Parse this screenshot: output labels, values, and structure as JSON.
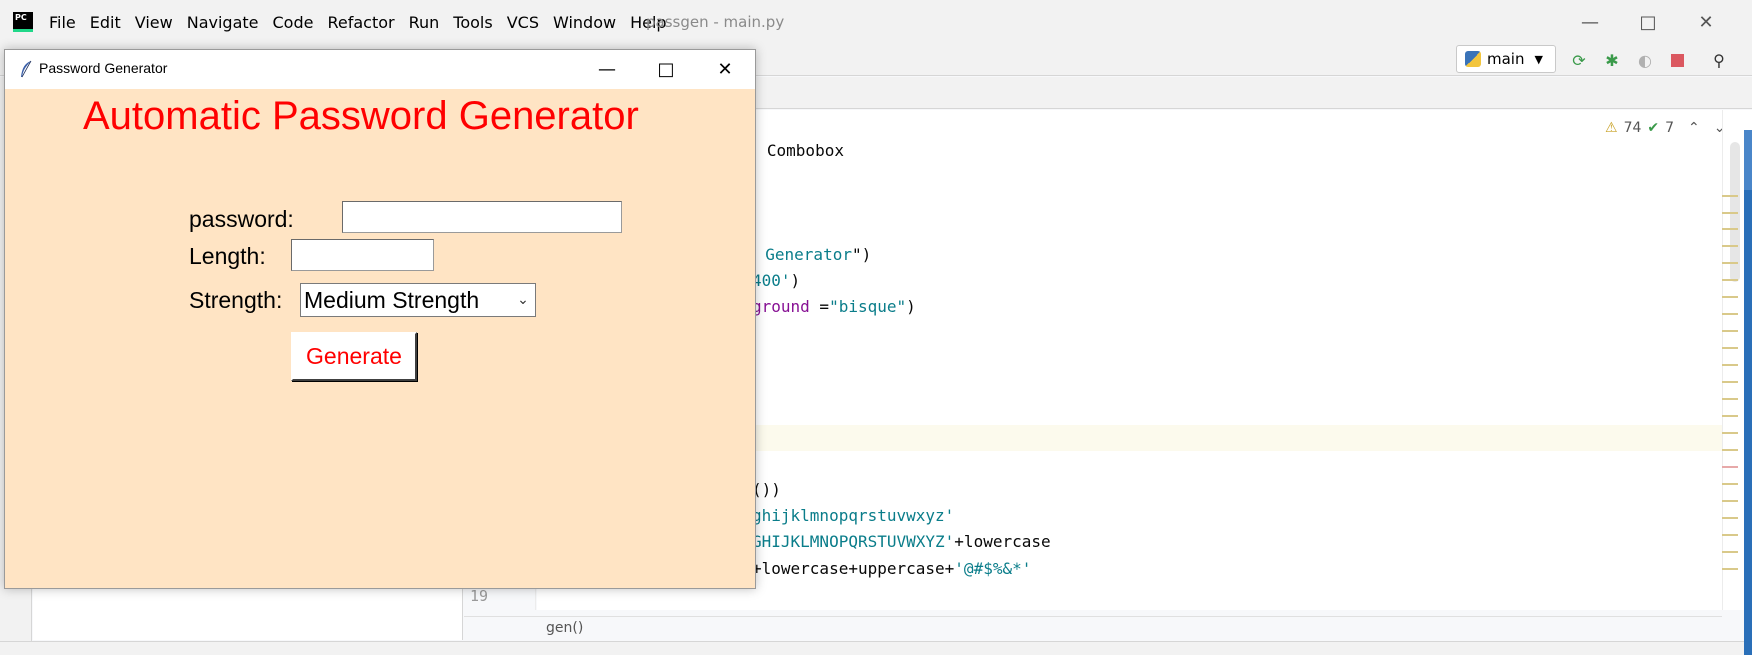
{
  "ide": {
    "title": "passgen - main.py",
    "logo_text": "PC",
    "menu": [
      "File",
      "Edit",
      "View",
      "Navigate",
      "Code",
      "Refactor",
      "Run",
      "Tools",
      "VCS",
      "Window",
      "Help"
    ],
    "run_config": "main",
    "inspections": {
      "warnings": "74",
      "typos": "7"
    },
    "line_number_visible": "19",
    "breadcrumb": "gen()",
    "code_fragments": [
      {
        "text": "rt Combobox"
      },
      {
        "text": "d Generator\")"
      },
      {
        "text": "400')"
      },
      {
        "text": "ground =\"bisque\")"
      },
      {
        "text": "())"
      },
      {
        "text": "ghijklmnopqrstuvwxyz'"
      },
      {
        "text": "GHIJKLMNOPQRSTUVWXYZ'+lowercase"
      },
      {
        "text": "+lowercase+uppercase+'@#$%&*'"
      }
    ],
    "colors": {
      "keyword": "#0033b3",
      "string": "#0a7d8a",
      "param": "#871094"
    }
  },
  "tk": {
    "title": "Password Generator",
    "heading": "Automatic Password Generator",
    "password_label": "password:",
    "password_value": "",
    "length_label": "Length:",
    "length_value": "",
    "strength_label": "Strength:",
    "strength_selected": "Medium Strength",
    "generate_label": "Generate",
    "colors": {
      "background": "#ffe4c4",
      "heading": "#ff0000",
      "button_text": "#ff0000"
    },
    "icons": {
      "app": "feather-icon",
      "minimize": "minimize-icon",
      "maximize": "maximize-icon",
      "close": "close-icon",
      "dropdown": "chevron-down-icon"
    }
  }
}
